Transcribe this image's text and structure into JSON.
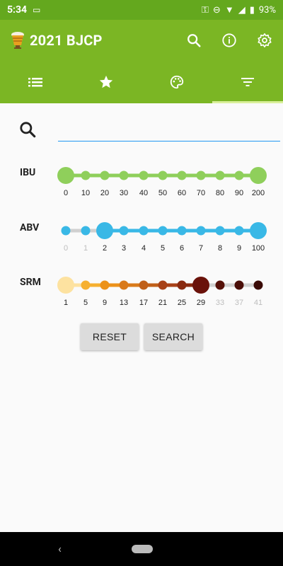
{
  "status": {
    "time": "5:34",
    "battery": "93%"
  },
  "app": {
    "title": "2021 BJCP"
  },
  "colors": {
    "primary": "#7bb624",
    "primary_dark": "#64a81e",
    "ibu": "#8fcf5b",
    "abv": "#39b8e6",
    "search_underline": "#2196f3"
  },
  "tabs": [
    {
      "icon": "list-icon",
      "active": false
    },
    {
      "icon": "star-icon",
      "active": false
    },
    {
      "icon": "palette-icon",
      "active": false
    },
    {
      "icon": "filter-icon",
      "active": true
    }
  ],
  "search": {
    "placeholder": "",
    "value": ""
  },
  "sliders": {
    "ibu": {
      "label": "IBU",
      "ticks": [
        "0",
        "10",
        "20",
        "30",
        "40",
        "50",
        "60",
        "70",
        "80",
        "90",
        "200"
      ],
      "selected_range": [
        "0",
        "200"
      ]
    },
    "abv": {
      "label": "ABV",
      "ticks": [
        "0",
        "1",
        "2",
        "3",
        "4",
        "5",
        "6",
        "7",
        "8",
        "9",
        "100"
      ],
      "selected_range": [
        "2",
        "100"
      ]
    },
    "srm": {
      "label": "SRM",
      "ticks": [
        "1",
        "5",
        "9",
        "13",
        "17",
        "21",
        "25",
        "29",
        "33",
        "37",
        "41"
      ],
      "selected_range": [
        "1",
        "29"
      ],
      "dot_colors": [
        "#fde2a0",
        "#f6b030",
        "#ec921a",
        "#d97a1b",
        "#c0601a",
        "#a84218",
        "#8a2a10",
        "#6a120a",
        "#551008",
        "#4a0e08",
        "#3a0a06"
      ]
    }
  },
  "buttons": {
    "reset": "RESET",
    "search": "SEARCH"
  }
}
